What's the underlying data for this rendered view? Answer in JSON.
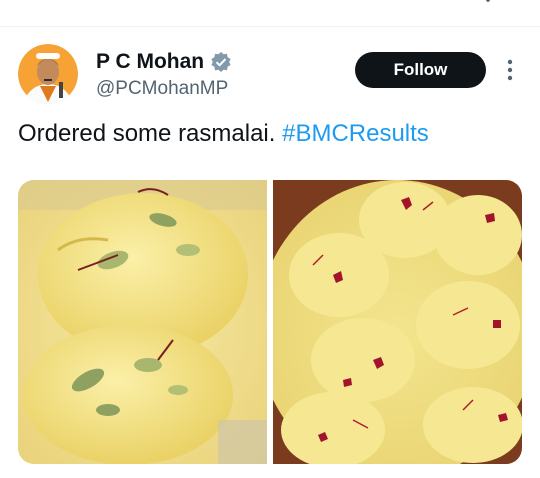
{
  "tweet": {
    "author_name": "P C Mohan",
    "author_handle": "@PCMohanMP",
    "follow_label": "Follow",
    "text_before": "Ordered some rasmalai. ",
    "hashtag": "#BMCResults",
    "media": [
      {
        "description_icon": "rasmalai-photo-1"
      },
      {
        "description_icon": "rasmalai-photo-2"
      }
    ]
  },
  "colors": {
    "accent": "#1d9bf0",
    "button_bg": "#0f1419",
    "secondary_text": "#536471",
    "verified": "#829aab"
  },
  "icons": {
    "verified": "verified-badge-icon",
    "more": "more-options-icon",
    "top": "chevron-down-icon"
  }
}
